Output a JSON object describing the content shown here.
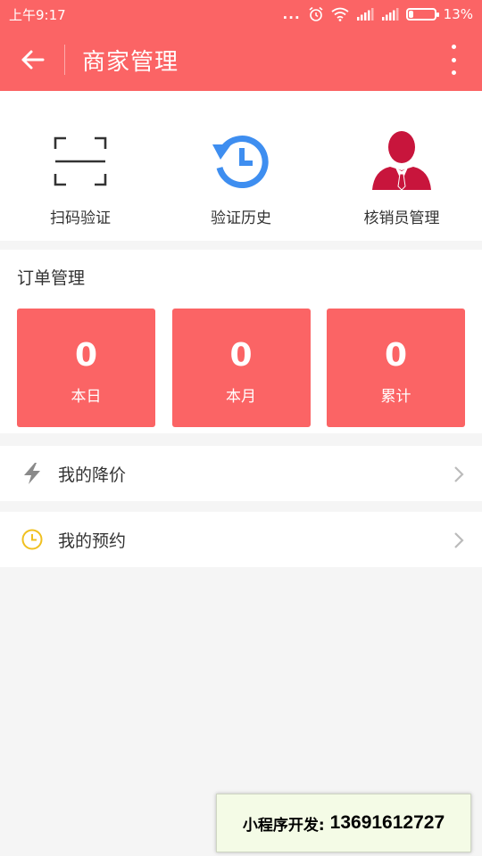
{
  "status_bar": {
    "time": "上午9:17",
    "dots": "...",
    "battery": "13%"
  },
  "app_bar": {
    "title": "商家管理"
  },
  "quick_actions": [
    {
      "label": "扫码验证",
      "icon": "scan-frame-icon"
    },
    {
      "label": "验证历史",
      "icon": "history-clock-icon"
    },
    {
      "label": "核销员管理",
      "icon": "staff-person-icon"
    }
  ],
  "orders": {
    "title": "订单管理",
    "stats": [
      {
        "value": "0",
        "label": "本日"
      },
      {
        "value": "0",
        "label": "本月"
      },
      {
        "value": "0",
        "label": "累计"
      }
    ]
  },
  "menu": [
    {
      "label": "我的降价",
      "icon": "lightning-icon"
    },
    {
      "label": "我的预约",
      "icon": "clock-icon"
    }
  ],
  "watermark": {
    "label": "小程序开发:",
    "phone": "13691612727"
  },
  "colors": {
    "brand": "#fb6465",
    "history_blue": "#3e8ef0",
    "staff_red": "#c8153c",
    "clock_yellow": "#f0c020"
  }
}
